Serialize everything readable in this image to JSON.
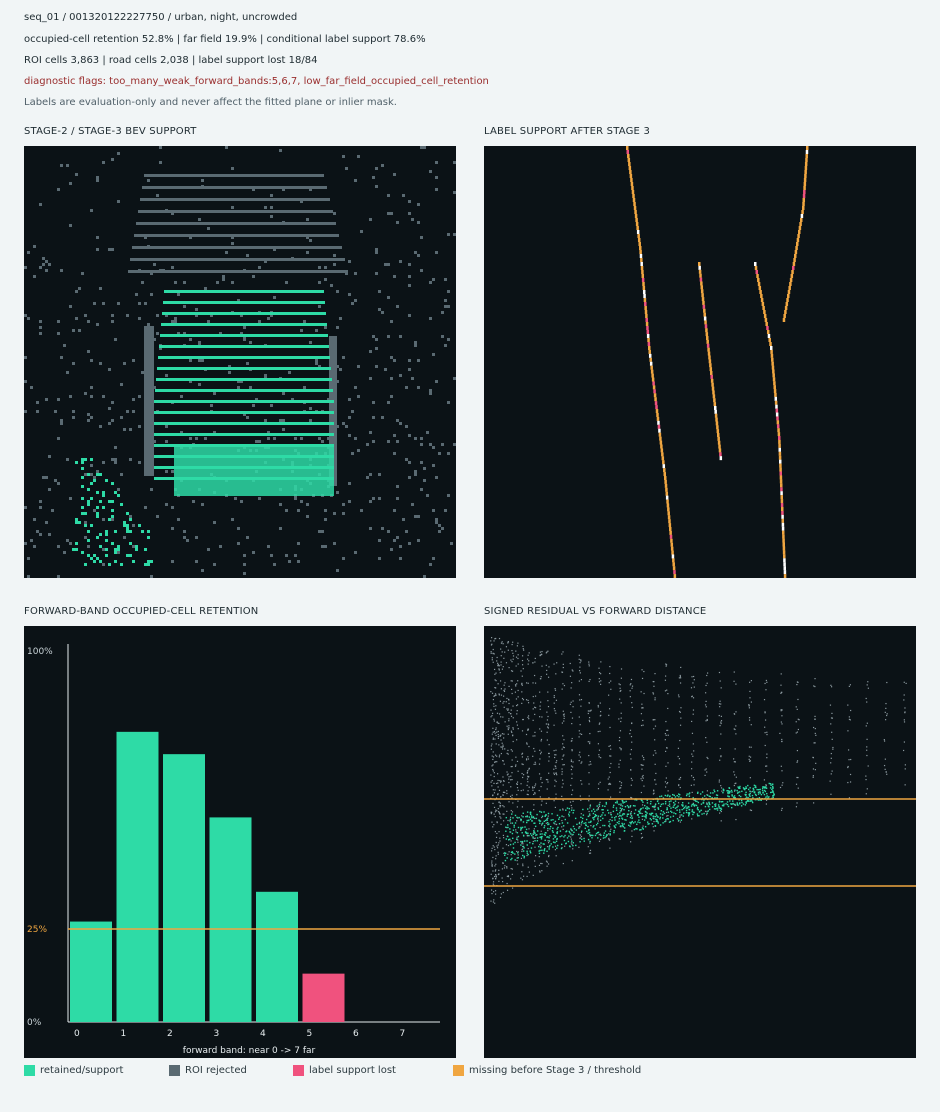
{
  "header": {
    "seq": "seq_01 / 001320122227750 / urban, night, uncrowded",
    "stats1": "occupied-cell retention 52.8% | far field 19.9% | conditional label support 78.6%",
    "stats2": "ROI cells 3,863 | road cells 2,038 | label support lost 18/84",
    "flags": "diagnostic flags: too_many_weak_forward_bands:5,6,7, low_far_field_occupied_cell_retention",
    "note": "Labels are evaluation-only and never affect the fitted plane or inlier mask."
  },
  "panels": {
    "bev_title": "STAGE-2 / STAGE-3 BEV SUPPORT",
    "label_title": "LABEL SUPPORT AFTER STAGE 3",
    "retention_title": "FORWARD-BAND OCCUPIED-CELL RETENTION",
    "residual_title": "SIGNED RESIDUAL VS FORWARD DISTANCE"
  },
  "colors": {
    "retained": "#2edba6",
    "rejected": "#5a6a72",
    "lost": "#f0527e",
    "missing": "#f0a641",
    "panel_bg": "#0b1216",
    "page_bg": "#f1f5f6"
  },
  "chart_data": [
    {
      "type": "bar",
      "title": "FORWARD-BAND OCCUPIED-CELL RETENTION",
      "xlabel": "forward band: near 0 -> 7 far",
      "ylabel": "",
      "categories": [
        "0",
        "1",
        "2",
        "3",
        "4",
        "5",
        "6",
        "7"
      ],
      "values": [
        27,
        78,
        72,
        55,
        35,
        13,
        0,
        0
      ],
      "bar_status": [
        "retained",
        "retained",
        "retained",
        "retained",
        "retained",
        "lost",
        "none",
        "none"
      ],
      "ylim": [
        0,
        100
      ],
      "yticks": [
        "0%",
        "25%",
        "100%"
      ],
      "threshold": 25,
      "threshold_label": "25%"
    },
    {
      "type": "scatter",
      "title": "SIGNED RESIDUAL VS FORWARD DISTANCE",
      "description_series": [
        "retained/support",
        "ROI rejected"
      ],
      "bands": "two horizontal threshold lines"
    }
  ],
  "legend": [
    {
      "label": "retained/support",
      "color": "#2edba6"
    },
    {
      "label": "ROI rejected",
      "color": "#5a6a72"
    },
    {
      "label": "label support lost",
      "color": "#f0527e"
    },
    {
      "label": "missing before Stage 3 / threshold",
      "color": "#f0a641"
    }
  ]
}
